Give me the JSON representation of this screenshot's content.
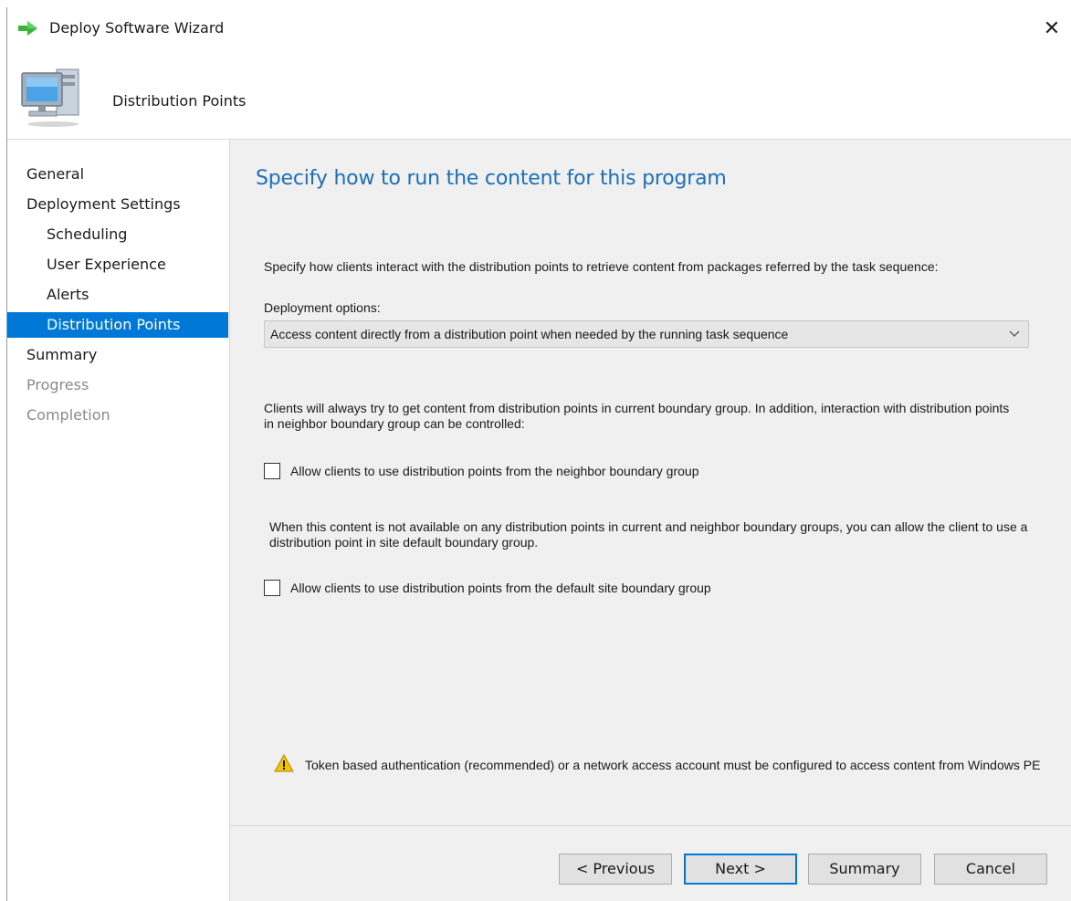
{
  "window": {
    "title": "Deploy Software Wizard",
    "close_glyph": "✕"
  },
  "header": {
    "title": "Distribution Points",
    "icon": "computer-icon"
  },
  "nav": {
    "items": [
      {
        "label": "General",
        "state": "normal"
      },
      {
        "label": "Deployment Settings",
        "state": "normal"
      },
      {
        "label": "Scheduling",
        "state": "normal"
      },
      {
        "label": "User Experience",
        "state": "normal"
      },
      {
        "label": "Alerts",
        "state": "normal"
      },
      {
        "label": "Distribution Points",
        "state": "selected"
      },
      {
        "label": "Summary",
        "state": "normal"
      },
      {
        "label": "Progress",
        "state": "disabled"
      },
      {
        "label": "Completion",
        "state": "disabled"
      }
    ]
  },
  "content": {
    "heading": "Specify how to run the content for this program",
    "intro": "Specify how clients interact with the distribution points to retrieve content from packages referred by the task sequence:",
    "deployment_options_label": "Deployment options:",
    "deployment_option_selected": "Access content directly from a distribution point when needed by the running task sequence",
    "boundary_text": "Clients will always try to get content from distribution points in current boundary group. In addition, interaction with distribution points in neighbor boundary group can be controlled:",
    "neighbor_checkbox_label": "Allow clients to use distribution points from the neighbor boundary group",
    "neighbor_checked": false,
    "fallback_text": "When this content is not available on any distribution points in current and neighbor boundary groups, you can allow the client to use a distribution point in site default boundary group.",
    "default_site_checkbox_label": "Allow clients to use distribution points from the default site boundary group",
    "default_site_checked": false,
    "warning_text": "Token based authentication (recommended) or a network access account must be configured to access content from Windows PE"
  },
  "footer": {
    "previous_label": "< Previous",
    "next_label": "Next >",
    "summary_label": "Summary",
    "cancel_label": "Cancel"
  },
  "colors": {
    "accent": "#0078d7",
    "heading": "#1c6fb8",
    "panel_bg": "#f0f0f0",
    "warning": "#f5c400"
  }
}
